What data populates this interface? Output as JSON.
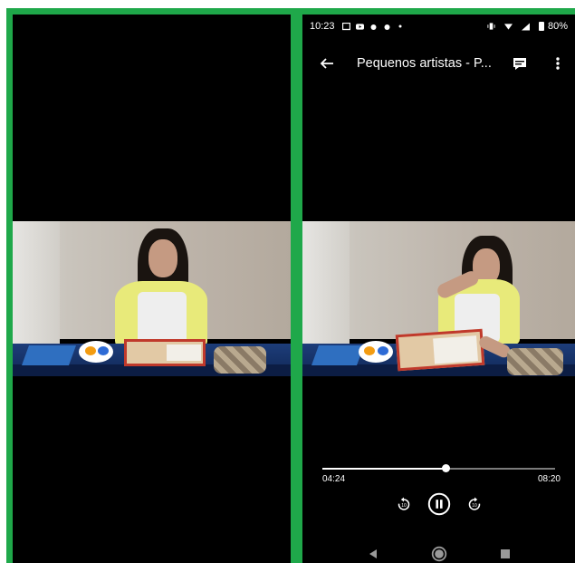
{
  "colors": {
    "frame_border": "#1fa84a",
    "background": "#000000",
    "text": "#ffffff"
  },
  "status_bar": {
    "time": "10:23",
    "battery": "80%",
    "icons": [
      "message-icon",
      "youtube-icon",
      "notification-icon",
      "notification-icon",
      "dot-icon",
      "vibrate-icon",
      "wifi-icon",
      "signal-icon",
      "battery-icon"
    ]
  },
  "app_bar": {
    "title": "Pequenos artistas - P...",
    "icons": [
      "back-arrow-icon",
      "subtitles-icon",
      "more-vert-icon"
    ]
  },
  "player": {
    "current_time": "04:24",
    "total_time": "08:20",
    "progress": 0.528,
    "controls": [
      "rewind-10-icon",
      "pause-icon",
      "forward-10-icon"
    ]
  },
  "nav_bar": {
    "icons": [
      "nav-back-icon",
      "nav-home-icon",
      "nav-recents-icon"
    ]
  }
}
